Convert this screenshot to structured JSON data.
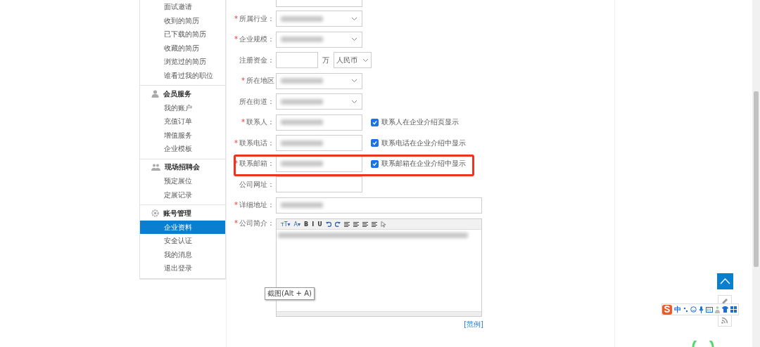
{
  "sidebar": {
    "groups": [
      {
        "items": [
          {
            "label": "面试邀请",
            "selected": false
          },
          {
            "label": "收到的简历",
            "selected": false
          },
          {
            "label": "已下载的简历",
            "selected": false
          },
          {
            "label": "收藏的简历",
            "selected": false
          },
          {
            "label": "浏览过的简历",
            "selected": false
          },
          {
            "label": "谁看过我的职位",
            "selected": false
          }
        ]
      },
      {
        "title": "会员服务",
        "kind": "person",
        "items": [
          {
            "label": "我的账户",
            "selected": false
          },
          {
            "label": "充值订单",
            "selected": false
          },
          {
            "label": "增值服务",
            "selected": false
          },
          {
            "label": "企业模板",
            "selected": false
          }
        ]
      },
      {
        "title": "现场招聘会",
        "kind": "people",
        "items": [
          {
            "label": "预定展位",
            "selected": false
          },
          {
            "label": "定展记录",
            "selected": false
          }
        ]
      },
      {
        "title": "账号管理",
        "kind": "gear",
        "items": [
          {
            "label": "企业资料",
            "selected": true
          },
          {
            "label": "安全认证",
            "selected": false
          },
          {
            "label": "我的消息",
            "selected": false
          },
          {
            "label": "退出登录",
            "selected": false
          }
        ]
      }
    ]
  },
  "form": {
    "rows": [
      {
        "kind": "select",
        "label": "所属行业：",
        "required_mark": "*",
        "hidden_value": true
      },
      {
        "kind": "select",
        "label": "企业规模：",
        "required_mark": "*",
        "hidden_value": true
      },
      {
        "kind": "money",
        "label": "注册资金：",
        "unit": "万",
        "currency": "人民币"
      },
      {
        "kind": "select",
        "label": "所在地区",
        "required_mark": "*",
        "hidden_value": true
      },
      {
        "kind": "select",
        "label": "所在街道：",
        "hidden_value": true
      },
      {
        "kind": "input",
        "label": "联系人：",
        "required_mark": "*",
        "hidden_value": true,
        "checkbox": {
          "label": "联系人在企业介绍页显示",
          "checked": true
        }
      },
      {
        "kind": "input",
        "label": "联系电话：",
        "required_mark": "*",
        "hidden_value": true,
        "checkbox": {
          "label": "联系电话在企业介绍中显示",
          "checked": true
        }
      },
      {
        "kind": "input",
        "label": "联系邮箱：",
        "required_mark": "*",
        "hidden_value": true,
        "highlighted": true,
        "checkbox": {
          "label": "联系邮箱在企业介绍中显示",
          "checked": true
        }
      },
      {
        "kind": "input",
        "label": "公司网址："
      },
      {
        "kind": "wide",
        "label": "详细地址：",
        "required_mark": "*",
        "hidden_value": true
      },
      {
        "kind": "editor",
        "label": "公司简介：",
        "required_mark": "*",
        "hidden_value": true,
        "link": "[范例]"
      }
    ],
    "toolbar": [
      {
        "kind": "text",
        "label": "ᴛT▾"
      },
      {
        "kind": "text",
        "label": "A▾"
      },
      {
        "kind": "text",
        "label": "B"
      },
      {
        "kind": "text",
        "label": "I"
      },
      {
        "kind": "text",
        "label": "U"
      },
      {
        "kind": "undo"
      },
      {
        "kind": "redo"
      },
      {
        "kind": "align"
      },
      {
        "kind": "align"
      },
      {
        "kind": "align"
      },
      {
        "kind": "align"
      },
      {
        "kind": "cursor"
      }
    ]
  },
  "tooltip": "截图(Alt + A)",
  "ime_toolbar": {
    "label": "中"
  }
}
